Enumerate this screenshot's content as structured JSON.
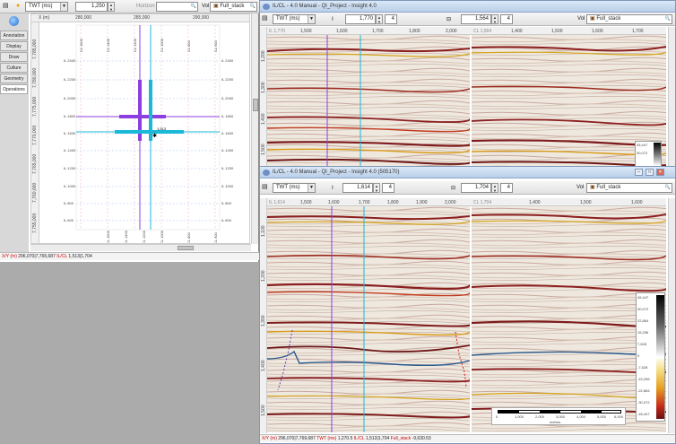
{
  "left": {
    "domain": "TWT (ms)",
    "value": "1,250",
    "horizon_label": "Horizon",
    "vol_label": "Vol",
    "vol_value": "Full_stack",
    "tabs": [
      "Annotation",
      "Display",
      "Draw",
      "Culture",
      "Geometry",
      "Operations"
    ],
    "top_ticks": [
      "X (m)",
      "280,000",
      "285,000",
      "290,000"
    ],
    "left_ticks": [
      "7,785,000",
      "7,780,000",
      "7,775,000",
      "7,770,000",
      "7,765,000",
      "7,760,000",
      "7,755,000"
    ],
    "il_labels": [
      "IL 2400",
      "IL 2200",
      "IL 2000",
      "IL 1800",
      "IL 1600",
      "IL 1400",
      "IL 1200",
      "IL 1000",
      "IL 800",
      "IL 600"
    ],
    "cl_labels": [
      "CL 1600",
      "CL 1400",
      "CL 1200",
      "CL 1000",
      "CL 800",
      "CL 600"
    ],
    "marker": "1,513",
    "status": {
      "xy_label": "X/Y (m)",
      "xy_value": "296,070|7,765,687",
      "ilcl_label": "IL/CL",
      "ilcl_value": "1,513|1,704"
    }
  },
  "right_top": {
    "title": "IL/CL - 4.0 Manual - QI_Project - Insight 4.0",
    "domain": "TWT (ms)",
    "il_value": "1,770",
    "il_step": "4",
    "cl_value": "1,564",
    "cl_step": "4",
    "vol_label": "Vol",
    "vol_value": "Full_stack",
    "il_section_label": "IL 1,770",
    "cl_section_label": "CL 1,564",
    "top_ticks_a": [
      "1,500",
      "1,600",
      "1,700",
      "1,800",
      "2,000"
    ],
    "top_ticks_b": [
      "1,400",
      "1,500",
      "1,600",
      "1,700"
    ],
    "depth_ticks": [
      "1,200",
      "1,300",
      "1,400",
      "1,500"
    ],
    "legend_values": [
      "45,447",
      "30,072"
    ]
  },
  "right_bottom": {
    "title": "IL/CL - 4.0 Manual - QI_Project - Insight 4.0 (505170)",
    "domain": "TWT (ms)",
    "il_value": "1,614",
    "il_step": "4",
    "cl_value": "1,704",
    "cl_step": "4",
    "vol_label": "Vol",
    "vol_value": "Full_stack",
    "il_section_label": "IL 1,614",
    "cl_section_label": "CL 1,704",
    "top_ticks_a": [
      "1,500",
      "1,600",
      "1,700",
      "1,800",
      "1,900",
      "2,000"
    ],
    "top_ticks_b": [
      "1,400",
      "1,500",
      "1,600"
    ],
    "depth_ticks": [
      "1,100",
      "1,200",
      "1,300",
      "1,400",
      "1,500"
    ],
    "legend_values": [
      "45,447",
      "30,072",
      "22,864",
      "15,256",
      "7,628",
      "0",
      "-7,628",
      "-15,256",
      "-22,864",
      "-30,072",
      "-45,447"
    ],
    "scalebar": [
      "0",
      "1,000",
      "2,000",
      "3,000",
      "4,000",
      "5,000",
      "6,000"
    ],
    "scalebar_unit": "metres",
    "status": {
      "xy_label": "X/Y (m)",
      "xy_value": "296,070|7,769,687",
      "twt_label": "TWT (ms)",
      "twt_value": "1,270.5",
      "ilcl_label": "IL/CL",
      "ilcl_value": "1,513|1,704",
      "vol_label": "Full_stack",
      "vol_value": "-9,630.53"
    }
  }
}
